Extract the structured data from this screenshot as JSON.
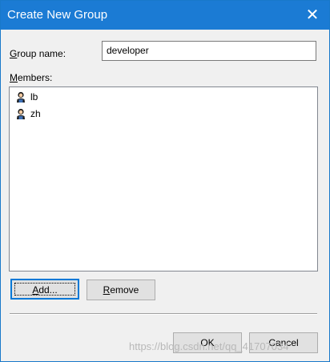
{
  "window": {
    "title": "Create New Group",
    "close_glyph": "✕"
  },
  "form": {
    "group_name": {
      "label_mnemonic": "G",
      "label_rest": "roup name:",
      "value": "developer"
    },
    "members": {
      "label_mnemonic": "M",
      "label_rest": "embers:",
      "items": [
        {
          "icon": "user-icon",
          "label": "lb"
        },
        {
          "icon": "user-icon",
          "label": "zh"
        }
      ]
    }
  },
  "buttons": {
    "add": {
      "mnemonic": "A",
      "rest": "dd..."
    },
    "remove": {
      "mnemonic": "R",
      "rest": "emove"
    },
    "ok": "OK",
    "cancel": "Cancel"
  },
  "watermark": "https://blog.csdn.net/qq_41707034"
}
